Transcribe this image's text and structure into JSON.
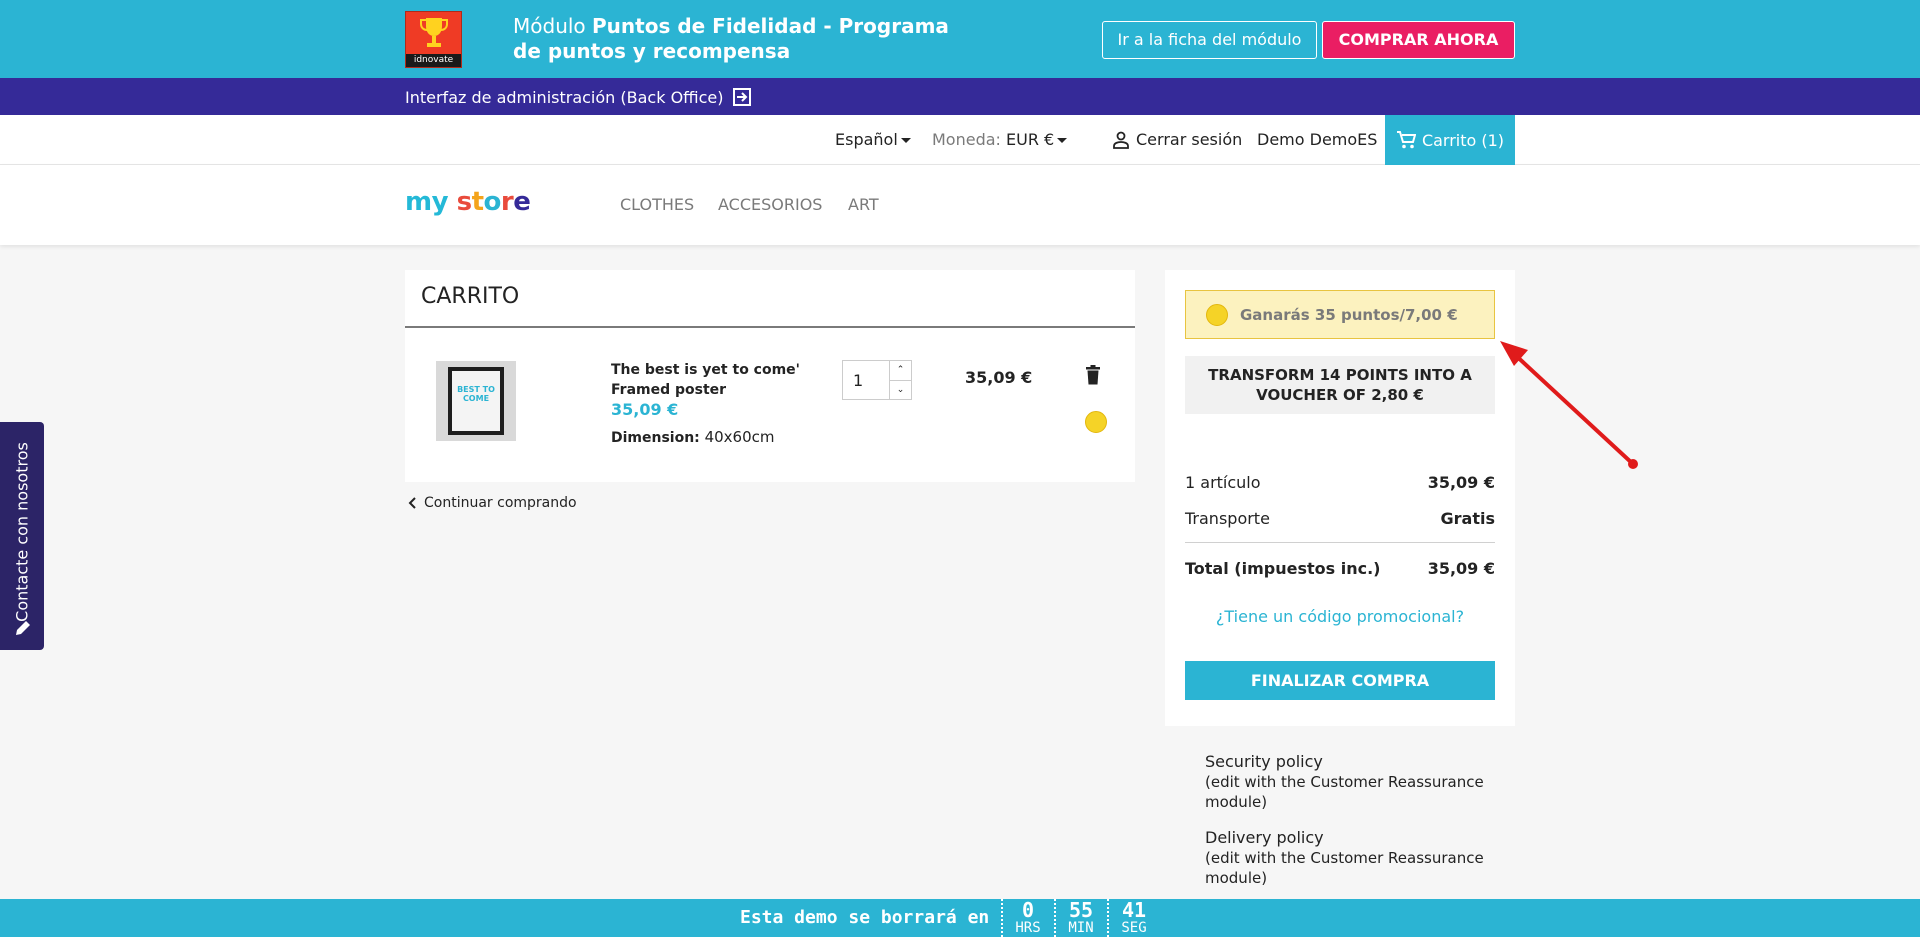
{
  "banner": {
    "logo_text": "idnovate",
    "title_prefix": "Módulo ",
    "title_bold": "Puntos de Fidelidad - Programa de puntos y recompensa",
    "module_link": "Ir a la ficha del módulo",
    "buy_button": "COMPRAR AHORA"
  },
  "admin_bar": {
    "label": "Interfaz de administración (Back Office)"
  },
  "nav": {
    "language": "Español",
    "currency_label": "Moneda:",
    "currency_value": "EUR €",
    "logout": "Cerrar sesión",
    "user": "Demo DemoES",
    "cart": "Carrito (1)"
  },
  "store": {
    "logo": "my store",
    "menu": [
      "CLOTHES",
      "ACCESORIOS",
      "ART"
    ]
  },
  "cart": {
    "title": "CARRITO",
    "item": {
      "name": "The best is yet to come' Framed poster",
      "price": "35,09 €",
      "attr_label": "Dimension:",
      "attr_value": "40x60cm",
      "quantity": "1",
      "total": "35,09 €",
      "thumb_text": "BEST TO COME"
    },
    "continue": "Continuar comprando"
  },
  "summary": {
    "points_text": "Ganarás 35 puntos/7,00 €",
    "transform_button": "TRANSFORM 14 POINTS INTO A VOUCHER OF 2,80 €",
    "items_label": "1 artículo",
    "items_value": "35,09 €",
    "shipping_label": "Transporte",
    "shipping_value": "Gratis",
    "total_label": "Total (impuestos inc.)",
    "total_value": "35,09 €",
    "promo_link": "¿Tiene un código promocional?",
    "checkout_button": "FINALIZAR COMPRA"
  },
  "reassurance": [
    {
      "title": "Security policy",
      "sub": "(edit with the Customer Reassurance module)"
    },
    {
      "title": "Delivery policy",
      "sub": "(edit with the Customer Reassurance module)"
    }
  ],
  "contact_tab": "Contacte con nosotros",
  "demo_bar": {
    "text": "Esta demo se borrará en",
    "hours": "0",
    "hours_label": "HRS",
    "minutes": "55",
    "minutes_label": "MIN",
    "seconds": "41",
    "seconds_label": "SEG"
  },
  "colors": {
    "accent": "#2bb4d3",
    "admin_bar": "#352a98",
    "buy_button": "#ea1e63",
    "contact_tab": "#2c2467",
    "points_bg": "#fcf2bf",
    "arrow": "#e01b1b"
  }
}
